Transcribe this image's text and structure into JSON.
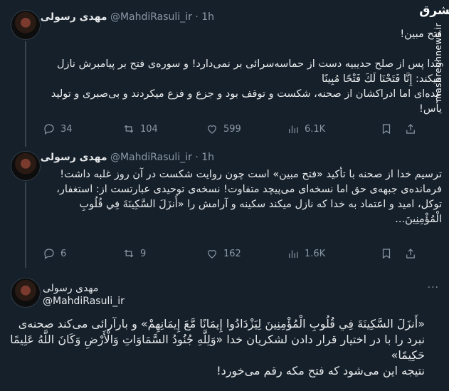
{
  "author": {
    "name": "مهدی رسولی",
    "handle": "@MahdiRasuli_ir",
    "dot": "·",
    "time": "1h"
  },
  "tweets": [
    {
      "text": "فتح مبین!\n\nخدا پس از صلح حدیبیه دست از حماسه‌سرائی بر نمی‌دارد! و سوره‌ی فتح بر پیامبرش نازل میکند: إِنَّا فَتَحْنَا لَكَ فَتْحًا مُبِينًا\nعده‌ای اما ادراکشان از صحنه، شکست و توقف بود و جزع و فزع میکردند و بی‌صبری و تولید یأس!",
      "replies": "34",
      "retweets": "104",
      "likes": "599",
      "views": "6.1K"
    },
    {
      "text": "ترسیم خدا از صحنه با تأکید «فتح مبین» است چون روایت شکست در آن روز غلبه داشت!\nفرمانده‌ی جبهه‌ی حق اما نسخه‌ای می‌پیچد متفاوت! نسخه‌ی توحیدی عبارتست از: استغفار، توکل، امید و اعتماد به خدا که نازل میکند سکینه و آرامش را «أَنزَلَ السَّكِينَةَ فِي قُلُوبِ الْمُؤْمِنِينَ...",
      "replies": "6",
      "retweets": "9",
      "likes": "162",
      "views": "1.6K"
    }
  ],
  "main_tweet": {
    "text": "«أَنزَلَ السَّكِينَةَ فِي قُلُوبِ الْمُؤْمِنِينَ لِيَزْدَادُوا إِيمَانًا مَّعَ إِيمَانِهِمْ» و بارآرائی می‌کند صحنه‌ی نبرد را با در اختیار قرار دادن لشکریان خدا «وَلِلَّهِ جُنُودُ السَّمَاوَاتِ وَالْأَرْضِ وَكَانَ اللَّهُ عَلِيمًا حَكِيمًا»\nنتیجه این می‌شود که فتح مکه رقم می‌خورد!"
  },
  "more_label": "···",
  "watermark": {
    "logo": "مشرق",
    "site": "mashreghnews.ir"
  },
  "colors": {
    "background": "#15202b",
    "text": "#e7e9ea",
    "muted": "#8b98a5",
    "divider": "#38444d"
  }
}
